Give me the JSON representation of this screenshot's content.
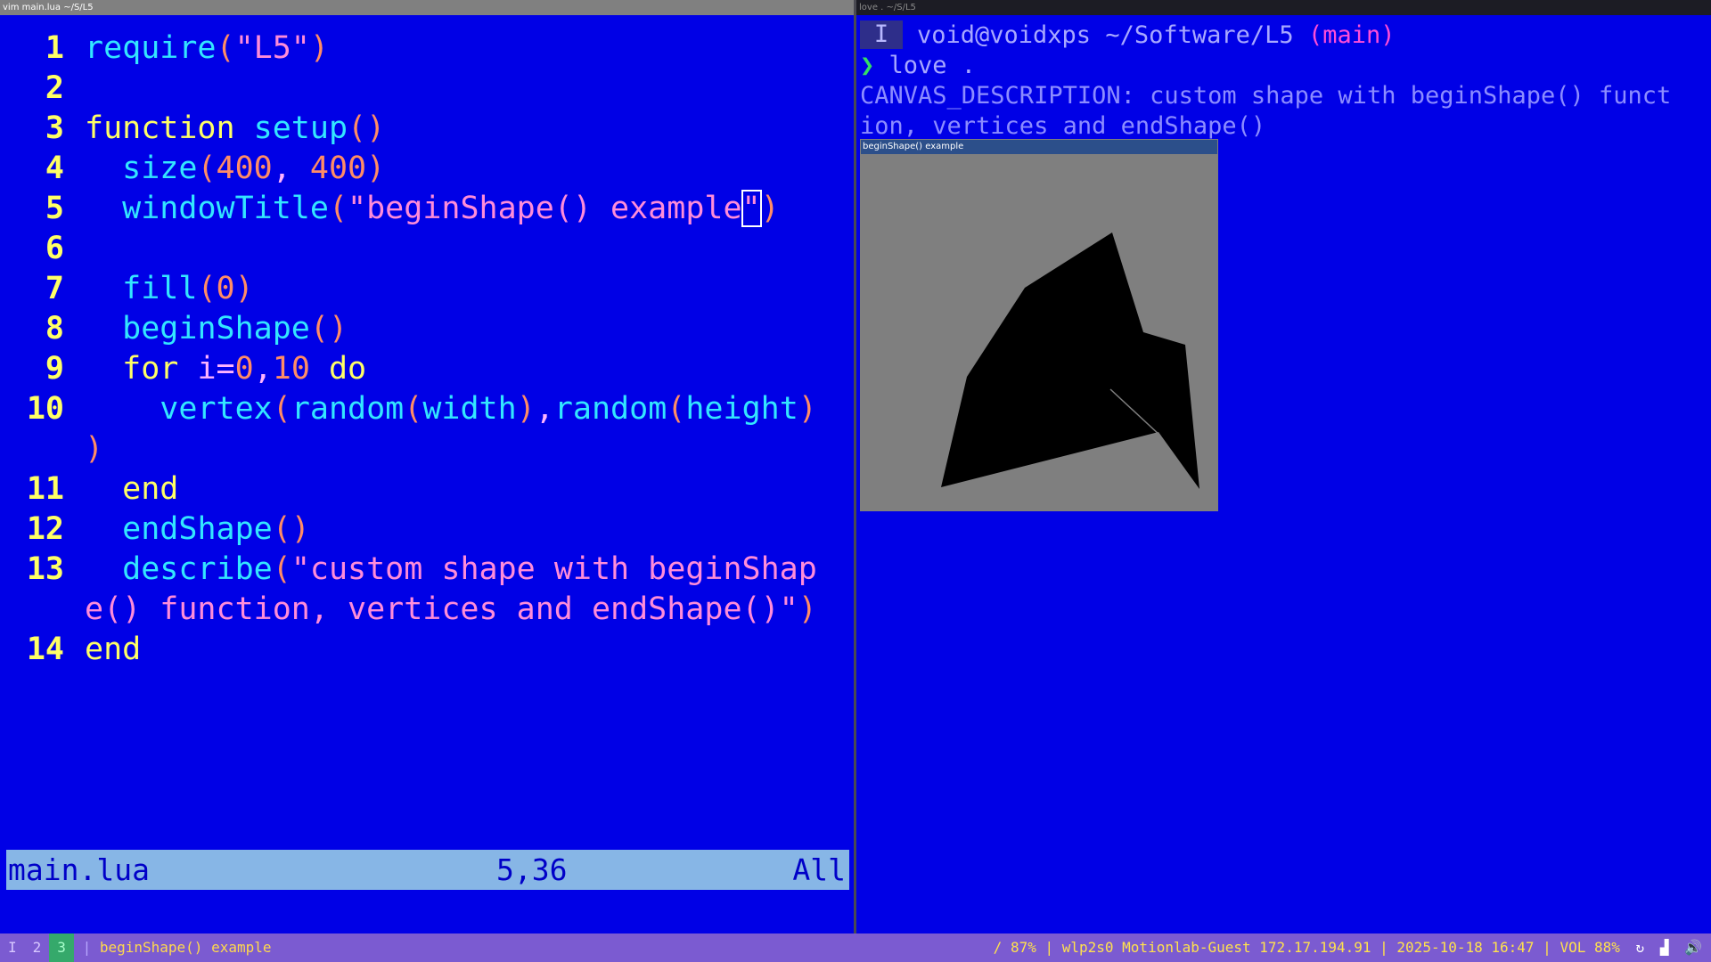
{
  "panes": {
    "left_title": "vim main.lua ~/S/L5",
    "right_title": "love . ~/S/L5"
  },
  "editor": {
    "lines": [
      {
        "n": "1",
        "segments": [
          [
            "fn",
            "require"
          ],
          [
            "par",
            "("
          ],
          [
            "str",
            "\"L5\""
          ],
          [
            "par",
            ")"
          ]
        ]
      },
      {
        "n": "2",
        "segments": []
      },
      {
        "n": "3",
        "segments": [
          [
            "kw",
            "function "
          ],
          [
            "fn",
            "setup"
          ],
          [
            "par",
            "()"
          ]
        ]
      },
      {
        "n": "4",
        "segments": [
          [
            "kw",
            "  "
          ],
          [
            "fn",
            "size"
          ],
          [
            "par",
            "("
          ],
          [
            "num",
            "400"
          ],
          [
            "op",
            ", "
          ],
          [
            "num",
            "400"
          ],
          [
            "par",
            ")"
          ]
        ]
      },
      {
        "n": "5",
        "segments": [
          [
            "kw",
            "  "
          ],
          [
            "fn",
            "windowTitle"
          ],
          [
            "par",
            "("
          ],
          [
            "str",
            "\"beginShape() example"
          ],
          [
            "cursor",
            "\""
          ],
          [
            "par",
            ")"
          ]
        ]
      },
      {
        "n": "6",
        "segments": []
      },
      {
        "n": "7",
        "segments": [
          [
            "kw",
            "  "
          ],
          [
            "fn",
            "fill"
          ],
          [
            "par",
            "("
          ],
          [
            "num",
            "0"
          ],
          [
            "par",
            ")"
          ]
        ]
      },
      {
        "n": "8",
        "segments": [
          [
            "kw",
            "  "
          ],
          [
            "fn",
            "beginShape"
          ],
          [
            "par",
            "()"
          ]
        ]
      },
      {
        "n": "9",
        "segments": [
          [
            "kw",
            "  for "
          ],
          [
            "op",
            "i="
          ],
          [
            "num",
            "0"
          ],
          [
            "op",
            ","
          ],
          [
            "num",
            "10"
          ],
          [
            "kw",
            " do"
          ]
        ]
      },
      {
        "n": "10",
        "segments": [
          [
            "kw",
            "    "
          ],
          [
            "fn",
            "vertex"
          ],
          [
            "par",
            "("
          ],
          [
            "fn",
            "random"
          ],
          [
            "par",
            "("
          ],
          [
            "fn",
            "width"
          ],
          [
            "par",
            ")"
          ],
          [
            "op",
            ","
          ],
          [
            "fn",
            "random"
          ],
          [
            "par",
            "("
          ],
          [
            "fn",
            "height"
          ],
          [
            "par",
            ")"
          ]
        ]
      },
      {
        "n": "",
        "segments": [
          [
            "par",
            ")"
          ]
        ]
      },
      {
        "n": "11",
        "segments": [
          [
            "kw",
            "  end"
          ]
        ]
      },
      {
        "n": "12",
        "segments": [
          [
            "kw",
            "  "
          ],
          [
            "fn",
            "endShape"
          ],
          [
            "par",
            "()"
          ]
        ]
      },
      {
        "n": "13",
        "segments": [
          [
            "kw",
            "  "
          ],
          [
            "fn",
            "describe"
          ],
          [
            "par",
            "("
          ],
          [
            "str",
            "\"custom shape with beginShap"
          ]
        ]
      },
      {
        "n": "",
        "segments": [
          [
            "str",
            "e() function, vertices and endShape()\""
          ],
          [
            "par",
            ")"
          ]
        ]
      },
      {
        "n": "14",
        "segments": [
          [
            "kw",
            "end"
          ]
        ]
      }
    ],
    "status": {
      "file": "main.lua",
      "position": "5,36",
      "scroll": "All"
    }
  },
  "terminal": {
    "mode": "I",
    "user_host": "void@voidxps",
    "path": "~/Software/L5",
    "branch": "(main)",
    "prompt_char": "❯",
    "command": "love .",
    "output": [
      "CANVAS_DESCRIPTION: custom shape with beginShape() funct",
      "ion, vertices and endShape()"
    ]
  },
  "love_window": {
    "title": "beginShape() example",
    "background": "#7f7f7f",
    "fill": "#000000"
  },
  "bottombar": {
    "workspaces": [
      "I",
      "2",
      "3"
    ],
    "active_workspace": "3",
    "window_title": "beginShape() example",
    "status": "/ 87% | wlp2s0 Motionlab-Guest 172.17.194.91 | 2025-10-18 16:47 | VOL 88%"
  }
}
